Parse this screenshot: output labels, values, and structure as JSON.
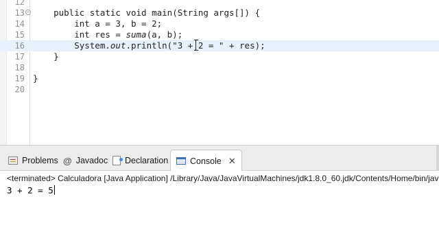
{
  "editor": {
    "lines": [
      {
        "num": "12",
        "code": ""
      },
      {
        "num": "13",
        "code_parts": [
          "    public static void main(String args[]) {"
        ]
      },
      {
        "num": "14",
        "code_parts": [
          "        int a = 3, b = 2;"
        ]
      },
      {
        "num": "15",
        "code_parts": [
          "        int res = ",
          "suma",
          "(a, b);"
        ]
      },
      {
        "num": "16",
        "code_parts": [
          "        System.",
          "out",
          ".println(\"3 + 2 = \" + res);"
        ]
      },
      {
        "num": "17",
        "code_parts": [
          "    }"
        ]
      },
      {
        "num": "18",
        "code_parts": [
          ""
        ]
      },
      {
        "num": "19",
        "code_parts": [
          "}"
        ]
      },
      {
        "num": "20",
        "code_parts": [
          ""
        ]
      }
    ],
    "current_line": "16",
    "fold_marker_line": "13"
  },
  "tabs": [
    {
      "label": "Problems",
      "icon": "problems-icon"
    },
    {
      "label": "Javadoc",
      "icon": "javadoc-icon"
    },
    {
      "label": "Declaration",
      "icon": "declaration-icon"
    },
    {
      "label": "Console",
      "icon": "console-icon",
      "active": true,
      "close": "✕"
    }
  ],
  "console": {
    "header": "<terminated> Calculadora [Java Application] /Library/Java/JavaVirtualMachines/jdk1.8.0_60.jdk/Contents/Home/bin/java",
    "output": "3 + 2 = 5"
  },
  "colors": {
    "current_line_bg": "#e8f2fe",
    "tab_bar_bg": "#ececec"
  }
}
